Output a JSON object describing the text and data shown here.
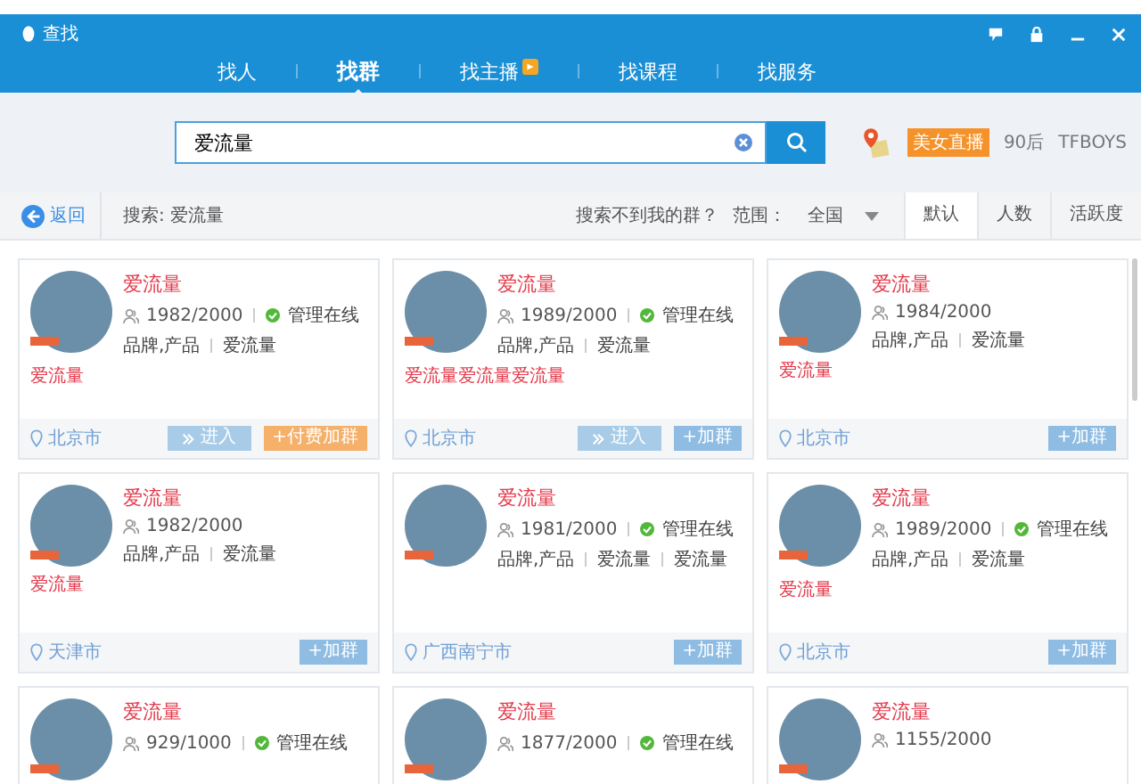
{
  "window": {
    "title": "查找"
  },
  "tabs": [
    {
      "label": "找人",
      "selected": false,
      "badge": false
    },
    {
      "label": "找群",
      "selected": true,
      "badge": false
    },
    {
      "label": "找主播",
      "selected": false,
      "badge": true
    },
    {
      "label": "找课程",
      "selected": false,
      "badge": false
    },
    {
      "label": "找服务",
      "selected": false,
      "badge": false
    }
  ],
  "search": {
    "value": "爱流量"
  },
  "hot_tags": [
    {
      "label": "美女直播",
      "kind": "tag"
    },
    {
      "label": "90后",
      "kind": "text"
    },
    {
      "label": "TFBOYS",
      "kind": "text"
    }
  ],
  "toolbar": {
    "back": "返回",
    "query": "搜索: 爱流量",
    "help": "搜索不到我的群？",
    "range_label": "范围：",
    "range": "全国"
  },
  "sort_tabs": [
    {
      "label": "默认",
      "selected": true
    },
    {
      "label": "人数",
      "selected": false
    },
    {
      "label": "活跃度",
      "selected": false
    }
  ],
  "groups": [
    {
      "name": "爱流量",
      "members": "1982/2000",
      "admin_online": true,
      "admin_text": "管理在线",
      "tags": [
        "品牌,产品",
        "爱流量"
      ],
      "description": "爱流量",
      "location": "北京市",
      "buttons": [
        {
          "label": "进入",
          "kind": "enter"
        },
        {
          "label": "+付费加群",
          "kind": "paid"
        }
      ]
    },
    {
      "name": "爱流量",
      "members": "1989/2000",
      "admin_online": true,
      "admin_text": "管理在线",
      "tags": [
        "品牌,产品",
        "爱流量"
      ],
      "description": "爱流量爱流量爱流量",
      "location": "北京市",
      "buttons": [
        {
          "label": "进入",
          "kind": "enter"
        },
        {
          "label": "+加群",
          "kind": "join"
        }
      ]
    },
    {
      "name": "爱流量",
      "members": "1984/2000",
      "admin_online": false,
      "tags": [
        "品牌,产品",
        "爱流量"
      ],
      "description": "爱流量",
      "location": "北京市",
      "buttons": [
        {
          "label": "+加群",
          "kind": "join"
        }
      ]
    },
    {
      "name": "爱流量",
      "members": "1982/2000",
      "admin_online": false,
      "tags": [
        "品牌,产品",
        "爱流量"
      ],
      "description": "爱流量",
      "location": "天津市",
      "buttons": [
        {
          "label": "+加群",
          "kind": "join"
        }
      ]
    },
    {
      "name": "爱流量",
      "members": "1981/2000",
      "admin_online": true,
      "admin_text": "管理在线",
      "tags": [
        "品牌,产品",
        "爱流量",
        "爱流量"
      ],
      "location": "广西南宁市",
      "buttons": [
        {
          "label": "+加群",
          "kind": "join"
        }
      ]
    },
    {
      "name": "爱流量",
      "members": "1989/2000",
      "admin_online": true,
      "admin_text": "管理在线",
      "tags": [
        "品牌,产品",
        "爱流量"
      ],
      "description": "爱流量",
      "location": "北京市",
      "buttons": [
        {
          "label": "+加群",
          "kind": "join"
        }
      ]
    },
    {
      "name": "爱流量",
      "members": "929/1000",
      "admin_online": true,
      "admin_text": "管理在线"
    },
    {
      "name": "爱流量",
      "members": "1877/2000",
      "admin_online": true,
      "admin_text": "管理在线"
    },
    {
      "name": "爱流量",
      "members": "1155/2000",
      "admin_online": false
    }
  ]
}
